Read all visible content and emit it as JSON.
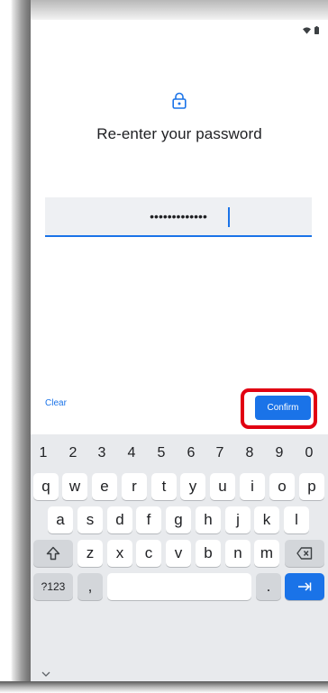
{
  "title": "Re-enter your password",
  "password": {
    "masked_value": "•••••••••••••"
  },
  "actions": {
    "clear_label": "Clear",
    "confirm_label": "Confirm"
  },
  "keyboard": {
    "number_row": [
      "1",
      "2",
      "3",
      "4",
      "5",
      "6",
      "7",
      "8",
      "9",
      "0"
    ],
    "row1": [
      "q",
      "w",
      "e",
      "r",
      "t",
      "y",
      "u",
      "i",
      "o",
      "p"
    ],
    "row2": [
      "a",
      "s",
      "d",
      "f",
      "g",
      "h",
      "j",
      "k",
      "l"
    ],
    "row3": [
      "z",
      "x",
      "c",
      "v",
      "b",
      "n",
      "m"
    ],
    "symbols_label": "?123",
    "comma_label": ",",
    "period_label": "."
  },
  "colors": {
    "accent": "#1a73e8",
    "highlight": "#e10012"
  },
  "icons": [
    "wifi-icon",
    "battery-icon",
    "lock-icon",
    "shift-icon",
    "backspace-icon",
    "enter-icon",
    "chevron-down-icon"
  ]
}
